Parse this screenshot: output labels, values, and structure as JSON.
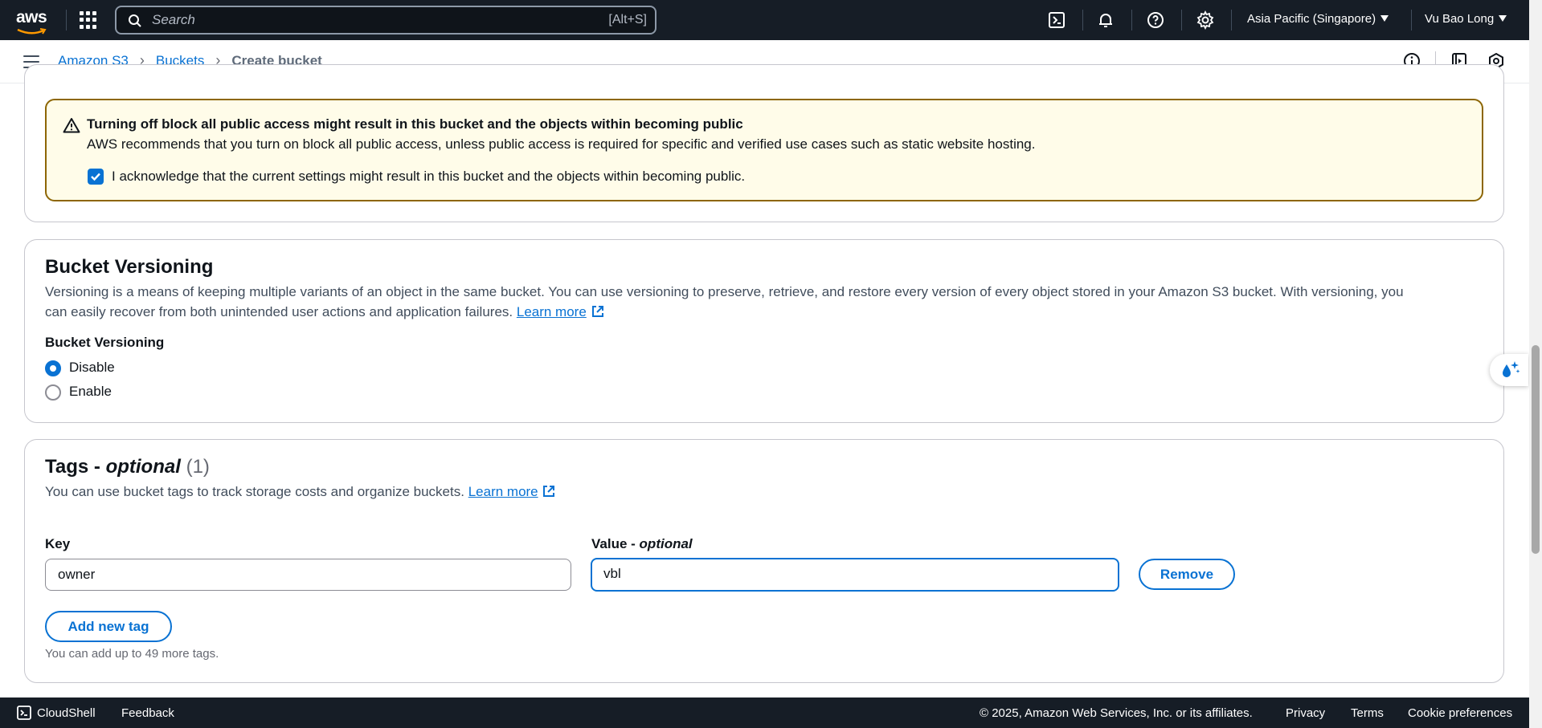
{
  "topnav": {
    "logo_text": "aws",
    "search_placeholder": "Search",
    "search_shortcut": "[Alt+S]",
    "region": "Asia Pacific (Singapore)",
    "user": "Vu Bao Long",
    "icons": [
      "cloudshell-icon",
      "bell-icon",
      "help-icon",
      "gear-icon"
    ]
  },
  "breadcrumb": {
    "items": [
      "Amazon S3",
      "Buckets"
    ],
    "current": "Create bucket"
  },
  "warning": {
    "title": "Turning off block all public access might result in this bucket and the objects within becoming public",
    "body": "AWS recommends that you turn on block all public access, unless public access is required for specific and verified use cases such as static website hosting.",
    "ack_label": "I acknowledge that the current settings might result in this bucket and the objects within becoming public.",
    "ack_checked": true
  },
  "versioning": {
    "title": "Bucket Versioning",
    "description_line1": "Versioning is a means of keeping multiple variants of an object in the same bucket. You can use versioning to preserve, retrieve, and restore every version of every object stored in your Amazon S3 bucket. With versioning, you",
    "description_line2": "can easily recover from both unintended user actions and application failures.",
    "learn_more": "Learn more",
    "field_label": "Bucket Versioning",
    "options": [
      "Disable",
      "Enable"
    ],
    "selected": "Disable"
  },
  "tags": {
    "title_main": "Tags -",
    "title_optional": "optional",
    "count": "(1)",
    "description": "You can use bucket tags to track storage costs and organize buckets.",
    "learn_more": "Learn more",
    "key_label": "Key",
    "value_label_main": "Value -",
    "value_label_optional": "optional",
    "key_value": "owner",
    "value_value": "vbl",
    "remove_button": "Remove",
    "add_button": "Add new tag",
    "limit_note": "You can add up to 49 more tags."
  },
  "footer": {
    "cloudshell": "CloudShell",
    "feedback": "Feedback",
    "copyright": "© 2025, Amazon Web Services, Inc. or its affiliates.",
    "privacy": "Privacy",
    "terms": "Terms",
    "cookies": "Cookie preferences"
  },
  "colors": {
    "nav_bg": "#161d26",
    "link": "#0972d3",
    "warning_bg": "#fffce9",
    "warning_border": "#8d6605"
  }
}
